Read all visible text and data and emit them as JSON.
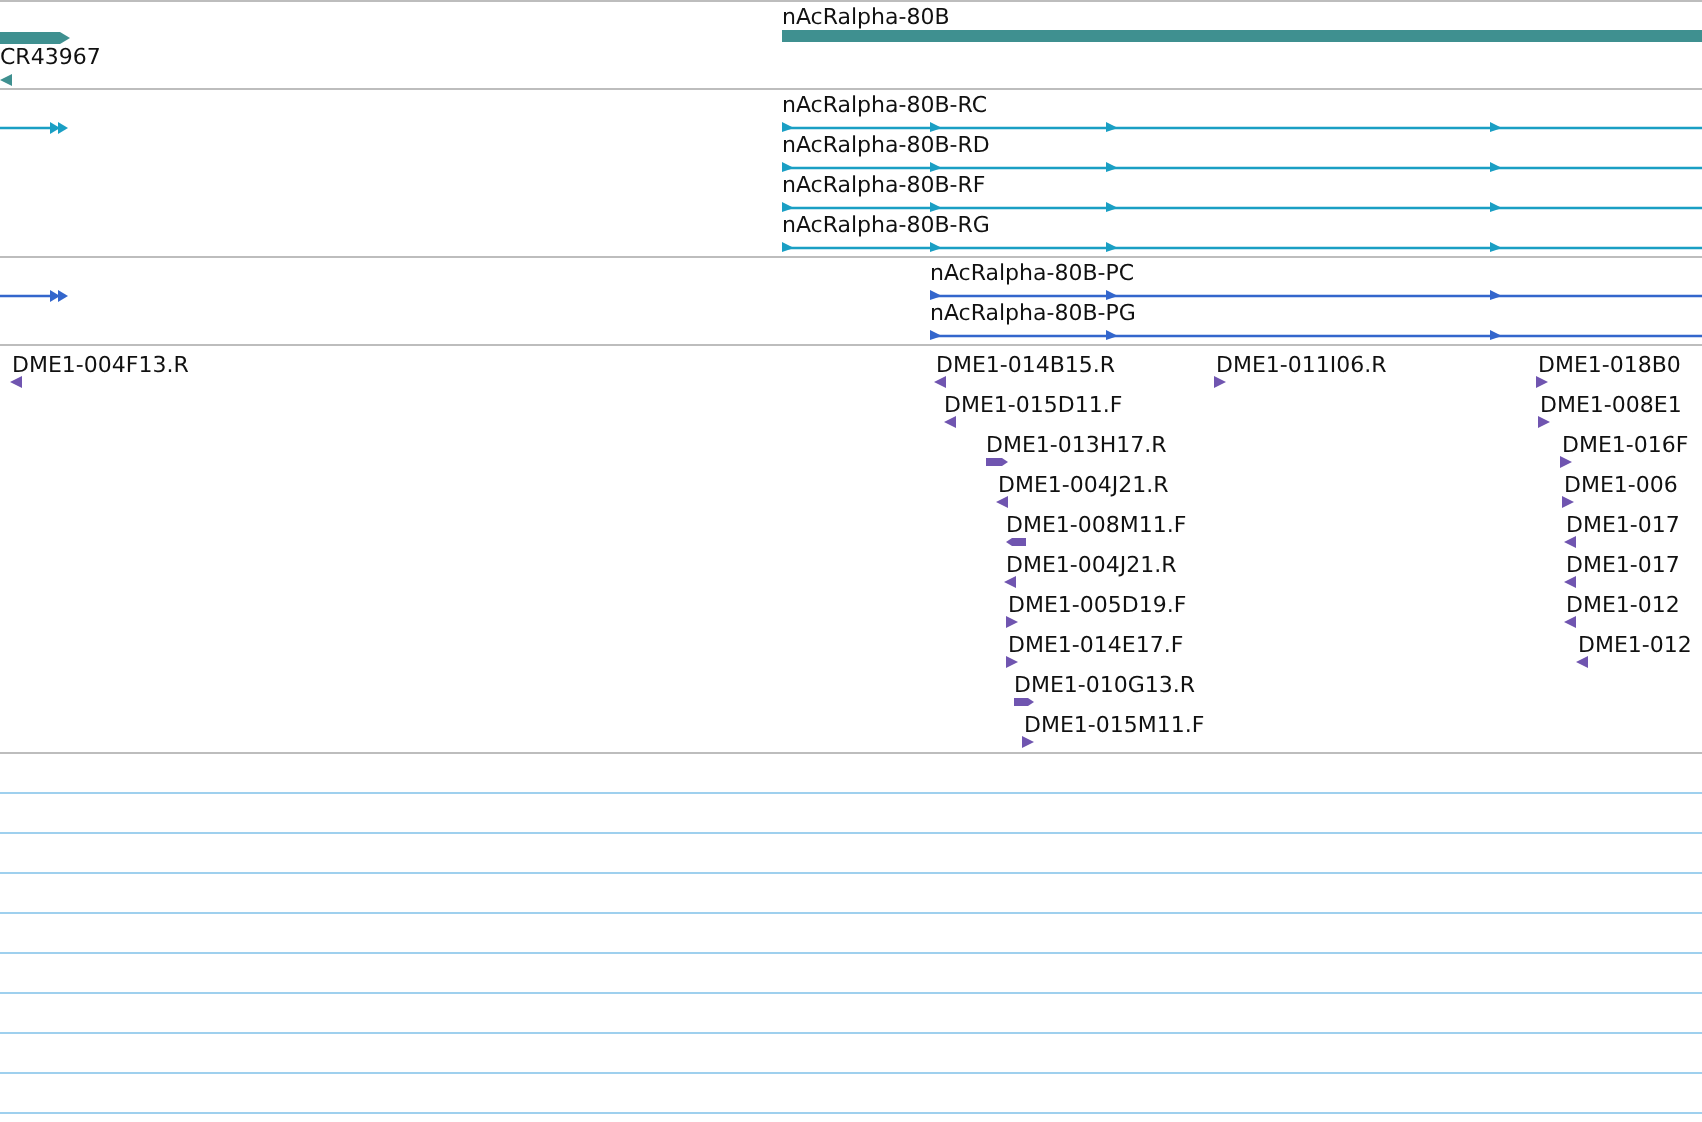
{
  "tracks": [
    {
      "kind": "genes",
      "features": [
        {
          "label": "CR43967",
          "forward": false
        },
        {
          "label": "nAcRalpha-80B",
          "forward": true
        }
      ]
    },
    {
      "kind": "transcripts",
      "features": [
        {
          "label": "nAcRalpha-80B-RC",
          "forward": true
        },
        {
          "label": "nAcRalpha-80B-RD",
          "forward": true
        },
        {
          "label": "nAcRalpha-80B-RF",
          "forward": true
        },
        {
          "label": "nAcRalpha-80B-RG",
          "forward": true
        }
      ]
    },
    {
      "kind": "proteins",
      "features": [
        {
          "label": "nAcRalpha-80B-PC",
          "forward": true
        },
        {
          "label": "nAcRalpha-80B-PG",
          "forward": true
        }
      ]
    },
    {
      "kind": "ests",
      "features": [
        {
          "label": "DME1-004F13.R",
          "forward": false
        },
        {
          "label": "DME1-014B15.R",
          "forward": false
        },
        {
          "label": "DME1-011I06.R",
          "forward": true
        },
        {
          "label": "DME1-018B0",
          "forward": true
        },
        {
          "label": "DME1-015D11.F",
          "forward": false
        },
        {
          "label": "DME1-008E1",
          "forward": true
        },
        {
          "label": "DME1-013H17.R",
          "forward": true
        },
        {
          "label": "DME1-016F",
          "forward": true
        },
        {
          "label": "DME1-004J21.R",
          "forward": false
        },
        {
          "label": "DME1-006",
          "forward": true
        },
        {
          "label": "DME1-008M11.F",
          "forward": false
        },
        {
          "label": "DME1-017",
          "forward": false
        },
        {
          "label": "DME1-004J21.R",
          "forward": false
        },
        {
          "label": "DME1-017",
          "forward": false
        },
        {
          "label": "DME1-005D19.F",
          "forward": true
        },
        {
          "label": "DME1-012",
          "forward": false
        },
        {
          "label": "DME1-014E17.F",
          "forward": true
        },
        {
          "label": "DME1-012",
          "forward": false
        },
        {
          "label": "DME1-010G13.R",
          "forward": true
        },
        {
          "label": "DME1-015M11.F",
          "forward": true
        }
      ]
    }
  ]
}
